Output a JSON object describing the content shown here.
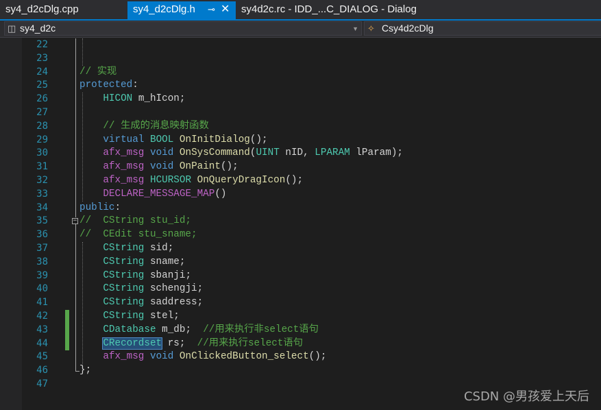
{
  "tabs": [
    {
      "label": "sy4_d2cDlg.cpp",
      "active": false
    },
    {
      "label": "sy4_d2cDlg.h",
      "active": true
    },
    {
      "label": "sy4d2c.rc - IDD_...C_DIALOG - Dialog",
      "active": false
    }
  ],
  "tab_icons": {
    "pin": "pin-icon",
    "close": "close-icon"
  },
  "nav": {
    "scope_label": "sy4_d2c",
    "scope_icon": "project-icon",
    "member_label": "Csy4d2cDlg",
    "member_icon": "class-icon"
  },
  "editor": {
    "lines": [
      {
        "n": "22",
        "code": ""
      },
      {
        "n": "23",
        "code": ""
      },
      {
        "n": "24",
        "code": "// 实现"
      },
      {
        "n": "25",
        "code": "protected:"
      },
      {
        "n": "26",
        "code": "    HICON m_hIcon;"
      },
      {
        "n": "27",
        "code": ""
      },
      {
        "n": "28",
        "code": "    // 生成的消息映射函数"
      },
      {
        "n": "29",
        "code": "    virtual BOOL OnInitDialog();"
      },
      {
        "n": "30",
        "code": "    afx_msg void OnSysCommand(UINT nID, LPARAM lParam);"
      },
      {
        "n": "31",
        "code": "    afx_msg void OnPaint();"
      },
      {
        "n": "32",
        "code": "    afx_msg HCURSOR OnQueryDragIcon();"
      },
      {
        "n": "33",
        "code": "    DECLARE_MESSAGE_MAP()"
      },
      {
        "n": "34",
        "code": "public:"
      },
      {
        "n": "35",
        "code": "//  CString stu_id;"
      },
      {
        "n": "36",
        "code": "//  CEdit stu_sname;"
      },
      {
        "n": "37",
        "code": "    CString sid;"
      },
      {
        "n": "38",
        "code": "    CString sname;"
      },
      {
        "n": "39",
        "code": "    CString sbanji;"
      },
      {
        "n": "40",
        "code": "    CString schengji;"
      },
      {
        "n": "41",
        "code": "    CString saddress;"
      },
      {
        "n": "42",
        "code": "    CString stel;"
      },
      {
        "n": "43",
        "code": "    CDatabase m_db;  //用来执行非select语句"
      },
      {
        "n": "44",
        "code": "    CRecordset rs;  //用来执行select语句"
      },
      {
        "n": "45",
        "code": "    afx_msg void OnClickedButton_select();"
      },
      {
        "n": "46",
        "code": "};"
      },
      {
        "n": "47",
        "code": ""
      }
    ]
  },
  "watermark": "CSDN @男孩爱上天后",
  "colors": {
    "keyword": "#569cd6",
    "type": "#4ec9b0",
    "function": "#dcdcaa",
    "macro": "#bd63c5",
    "comment": "#57a64a",
    "line_number": "#2b91af",
    "accent": "#007acc"
  }
}
